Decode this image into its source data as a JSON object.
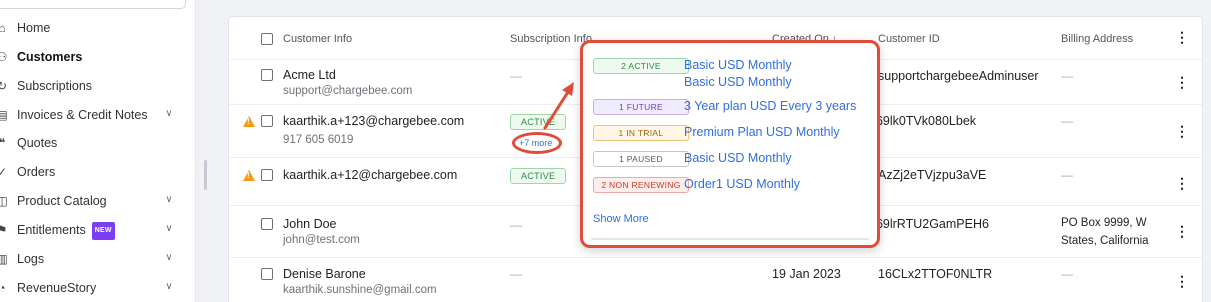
{
  "sidebar": {
    "items": [
      {
        "label": "Home",
        "icon": "home-icon",
        "glyph": "⌂",
        "chevron": false,
        "active": false
      },
      {
        "label": "Customers",
        "icon": "customers-icon",
        "glyph": "⚇",
        "chevron": false,
        "active": true
      },
      {
        "label": "Subscriptions",
        "icon": "subscriptions-icon",
        "glyph": "↻",
        "chevron": false,
        "active": false
      },
      {
        "label": "Invoices & Credit Notes",
        "icon": "invoice-icon",
        "glyph": "▤",
        "chevron": true,
        "active": false
      },
      {
        "label": "Quotes",
        "icon": "quotes-icon",
        "glyph": "❝",
        "chevron": false,
        "active": false
      },
      {
        "label": "Orders",
        "icon": "orders-icon",
        "glyph": "✓",
        "chevron": false,
        "active": false
      },
      {
        "label": "Product Catalog",
        "icon": "catalog-icon",
        "glyph": "◫",
        "chevron": true,
        "active": false
      },
      {
        "label": "Entitlements",
        "icon": "entitlements-icon",
        "glyph": "⚑",
        "chevron": true,
        "active": false,
        "badge": "NEW"
      },
      {
        "label": "Logs",
        "icon": "logs-icon",
        "glyph": "▥",
        "chevron": true,
        "active": false
      },
      {
        "label": "RevenueStory",
        "icon": "revenuestory-icon",
        "glyph": "◔",
        "chevron": true,
        "active": false
      }
    ]
  },
  "table": {
    "headers": {
      "customer_info": "Customer Info",
      "subscription_info": "Subscription Info",
      "created_on": "Created On",
      "sort_arrow": "↓",
      "customer_id": "Customer ID",
      "billing_address": "Billing Address"
    },
    "rows": [
      {
        "name": "Acme Ltd",
        "sub": "support@chargebee.com",
        "subscription": "—",
        "customer_id": "supportchargebeeAdminuser",
        "billing": "—",
        "warning": false
      },
      {
        "name": "kaarthik.a+123@chargebee.com",
        "sub": "917 605 6019",
        "status": "ACTIVE",
        "more": "+7 more",
        "customer_id": "169lk0TVk080Lbek",
        "billing": "—",
        "warning": true
      },
      {
        "name": "kaarthik.a+12@chargebee.com",
        "sub": "",
        "status": "ACTIVE",
        "customer_id": "AzZj2eTVjzpu3aVE",
        "billing": "—",
        "warning": true
      },
      {
        "name": "John Doe",
        "sub": "john@test.com",
        "subscription": "—",
        "customer_id": "169lrRTU2GamPEH6",
        "billing": "PO Box 9999, W",
        "billing2": "States, California",
        "warning": false
      },
      {
        "name": "Denise Barone",
        "sub": "kaarthik.sunshine@gmail.com",
        "subscription": "—",
        "created_on": "19 Jan 2023",
        "customer_id": "16CLx2TTOF0NLTR",
        "billing": "—",
        "warning": false
      }
    ]
  },
  "popover": {
    "items": [
      {
        "pill": "2 ACTIVE",
        "names": [
          "Basic USD Monthly",
          "Basic USD Monthly"
        ],
        "color": "#2f8a41",
        "bg": "#eef9f0",
        "border": "#9fd6a8"
      },
      {
        "pill": "1 FUTURE",
        "names": [
          "3 Year plan USD Every 3 years"
        ],
        "color": "#6a3fc8",
        "bg": "#f1ecfd",
        "border": "#c3afef"
      },
      {
        "pill": "1 IN TRIAL",
        "names": [
          "Premium Plan USD Monthly"
        ],
        "color": "#a0660c",
        "bg": "#fff6e6",
        "border": "#f0c27a"
      },
      {
        "pill": "1 PAUSED",
        "names": [
          "Basic USD Monthly"
        ],
        "color": "#555a61",
        "bg": "#ffffff",
        "border": "#c3c6cc"
      },
      {
        "pill": "2 NON RENEWING",
        "names": [
          "Order1 USD Monthly"
        ],
        "color": "#c8392b",
        "bg": "#fdeeec",
        "border": "#f0a9a0"
      }
    ],
    "show_more": "Show More"
  },
  "colors": {
    "annotation": "#e04b3a",
    "link": "#2f6fe0",
    "warning": "#f29d12"
  }
}
